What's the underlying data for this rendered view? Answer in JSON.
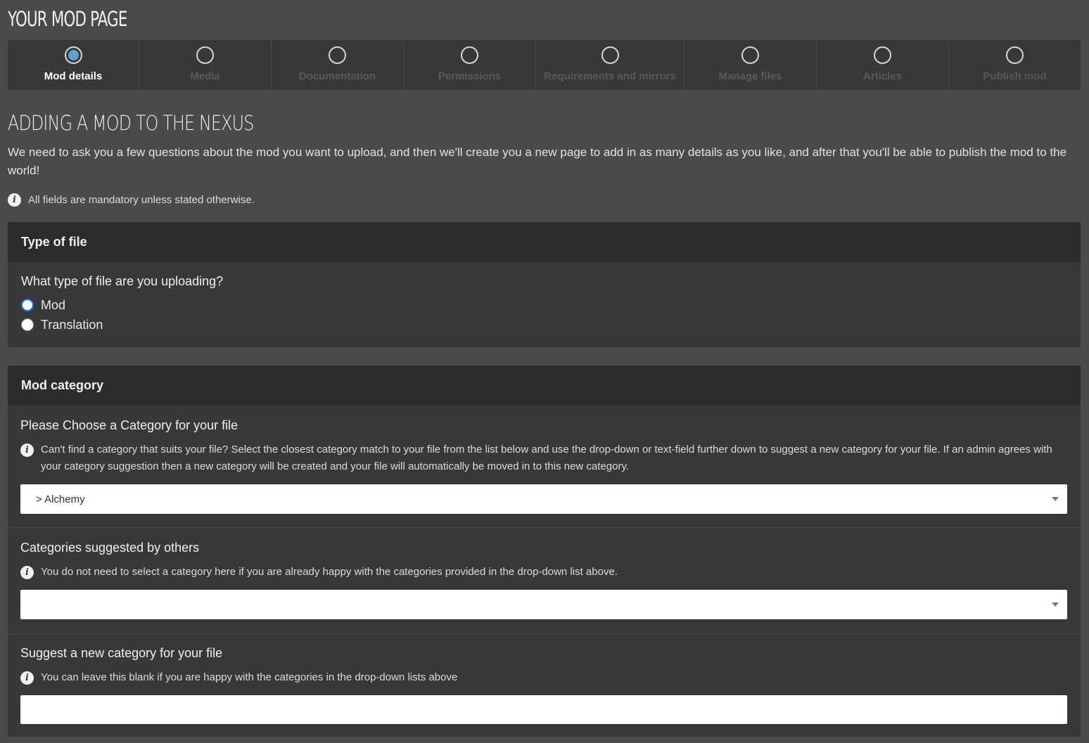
{
  "page": {
    "title": "YOUR MOD PAGE"
  },
  "steps": [
    {
      "label": "Mod details",
      "active": true
    },
    {
      "label": "Media",
      "active": false
    },
    {
      "label": "Documentation",
      "active": false
    },
    {
      "label": "Permissions",
      "active": false
    },
    {
      "label": "Requirements and mirrors",
      "active": false
    },
    {
      "label": "Manage files",
      "active": false
    },
    {
      "label": "Articles",
      "active": false
    },
    {
      "label": "Publish mod",
      "active": false
    }
  ],
  "main": {
    "heading": "ADDING A MOD TO THE NEXUS",
    "intro": "We need to ask you a few questions about the mod you want to upload, and then we'll create you a new page to add in as many details as you like, and after that you'll be able to publish the mod to the world!",
    "mandatory_note": "All fields are mandatory unless stated otherwise."
  },
  "type_panel": {
    "header": "Type of file",
    "question": "What type of file are you uploading?",
    "options": [
      {
        "label": "Mod",
        "checked": true
      },
      {
        "label": "Translation",
        "checked": false
      }
    ]
  },
  "category_panel": {
    "header": "Mod category",
    "choose_title": "Please Choose a Category for your file",
    "choose_help": "Can't find a category that suits your file? Select the closest category match to your file from the list below and use the drop-down or text-field further down to suggest a new category for your file. If an admin agrees with your category suggestion then a new category will be created and your file will automatically be moved in to this new category.",
    "category_selected": "> Alchemy",
    "suggested_title": "Categories suggested by others",
    "suggested_help": "You do not need to select a category here if you are already happy with the categories provided in the drop-down list above.",
    "suggested_selected": "",
    "new_title": "Suggest a new category for your file",
    "new_help": "You can leave this blank if you are happy with the categories in the drop-down lists above",
    "new_value": ""
  },
  "colors": {
    "background": "#4a4a4a",
    "panel": "#383838",
    "panel_header": "#2c2c2c",
    "accent": "#57a5cc",
    "radio_checked": "#1a73e8"
  },
  "icons": {
    "info": "info-icon",
    "step": "step-circle-icon",
    "dropdown": "chevron-down-icon"
  }
}
